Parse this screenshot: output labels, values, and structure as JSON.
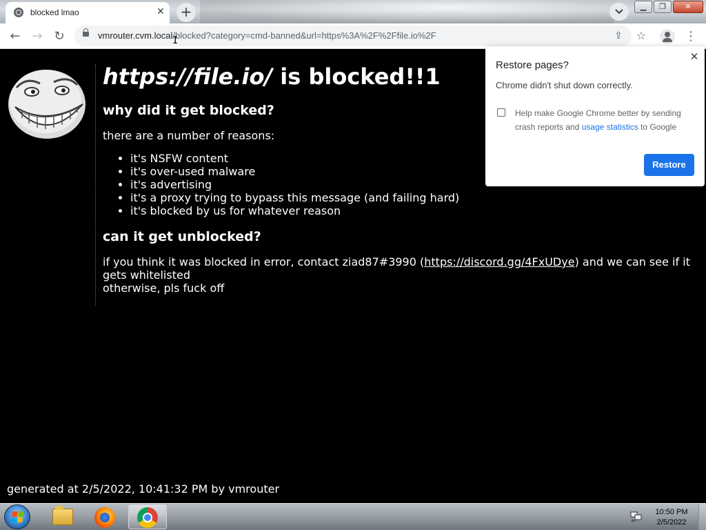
{
  "browser": {
    "tab": {
      "title": "blocked lmao",
      "favicon": "globe-icon",
      "close_icon": "close-icon"
    },
    "new_tab_icon": "plus-icon",
    "tab_search_icon": "chevron-down-icon",
    "window_controls": {
      "minimize": "minimize-icon",
      "maximize": "maximize-icon",
      "close": "close-icon"
    },
    "toolbar": {
      "back_icon": "arrow-left-icon",
      "forward_icon": "arrow-right-icon",
      "reload_icon": "reload-icon",
      "lock_icon": "lock-icon",
      "url_host": "vmrouter.cvm.local",
      "url_path": "/blocked?category=cmd-banned&url=https%3A%2F%2Ffile.io%2F",
      "share_icon": "share-icon",
      "bookmark_icon": "star-icon",
      "profile_icon": "profile-icon",
      "menu_icon": "kebab-menu-icon"
    }
  },
  "page": {
    "heading_site": "https://file.io/",
    "heading_suffix": " is blocked!!1",
    "why_heading": "why did it get blocked?",
    "reasons_intro": "there are a number of reasons:",
    "reasons": [
      "it's NSFW content",
      "it's over-used malware",
      "it's advertising",
      "it's a proxy trying to bypass this message (and failing hard)",
      "it's blocked by us for whatever reason"
    ],
    "unblock_heading": "can it get unblocked?",
    "unblock_text_before": "if you think it was blocked in error, contact ziad87#3990 (",
    "unblock_link": "https://discord.gg/4FxUDye",
    "unblock_text_after": ") and we can see if it gets whitelisted",
    "unblock_otherwise": "otherwise, pls fuck off",
    "footer": "generated at 2/5/2022, 10:41:32 PM by vmrouter",
    "image": "troll-face"
  },
  "restore_popup": {
    "title": "Restore pages?",
    "subtitle": "Chrome didn't shut down correctly.",
    "checkbox_text_before": "Help make Google Chrome better by sending crash reports and ",
    "checkbox_link": "usage statistics",
    "checkbox_text_after": " to Google",
    "checkbox_checked": false,
    "restore_button": "Restore",
    "close_icon": "close-icon",
    "accent_color": "#1a73e8"
  },
  "taskbar": {
    "start_icon": "windows-start-icon",
    "apps": [
      "file-explorer-icon",
      "firefox-icon",
      "chrome-icon"
    ],
    "active_app": "chrome-icon",
    "tray_icon": "network-icon",
    "clock_time": "10:50 PM",
    "clock_date": "2/5/2022"
  }
}
